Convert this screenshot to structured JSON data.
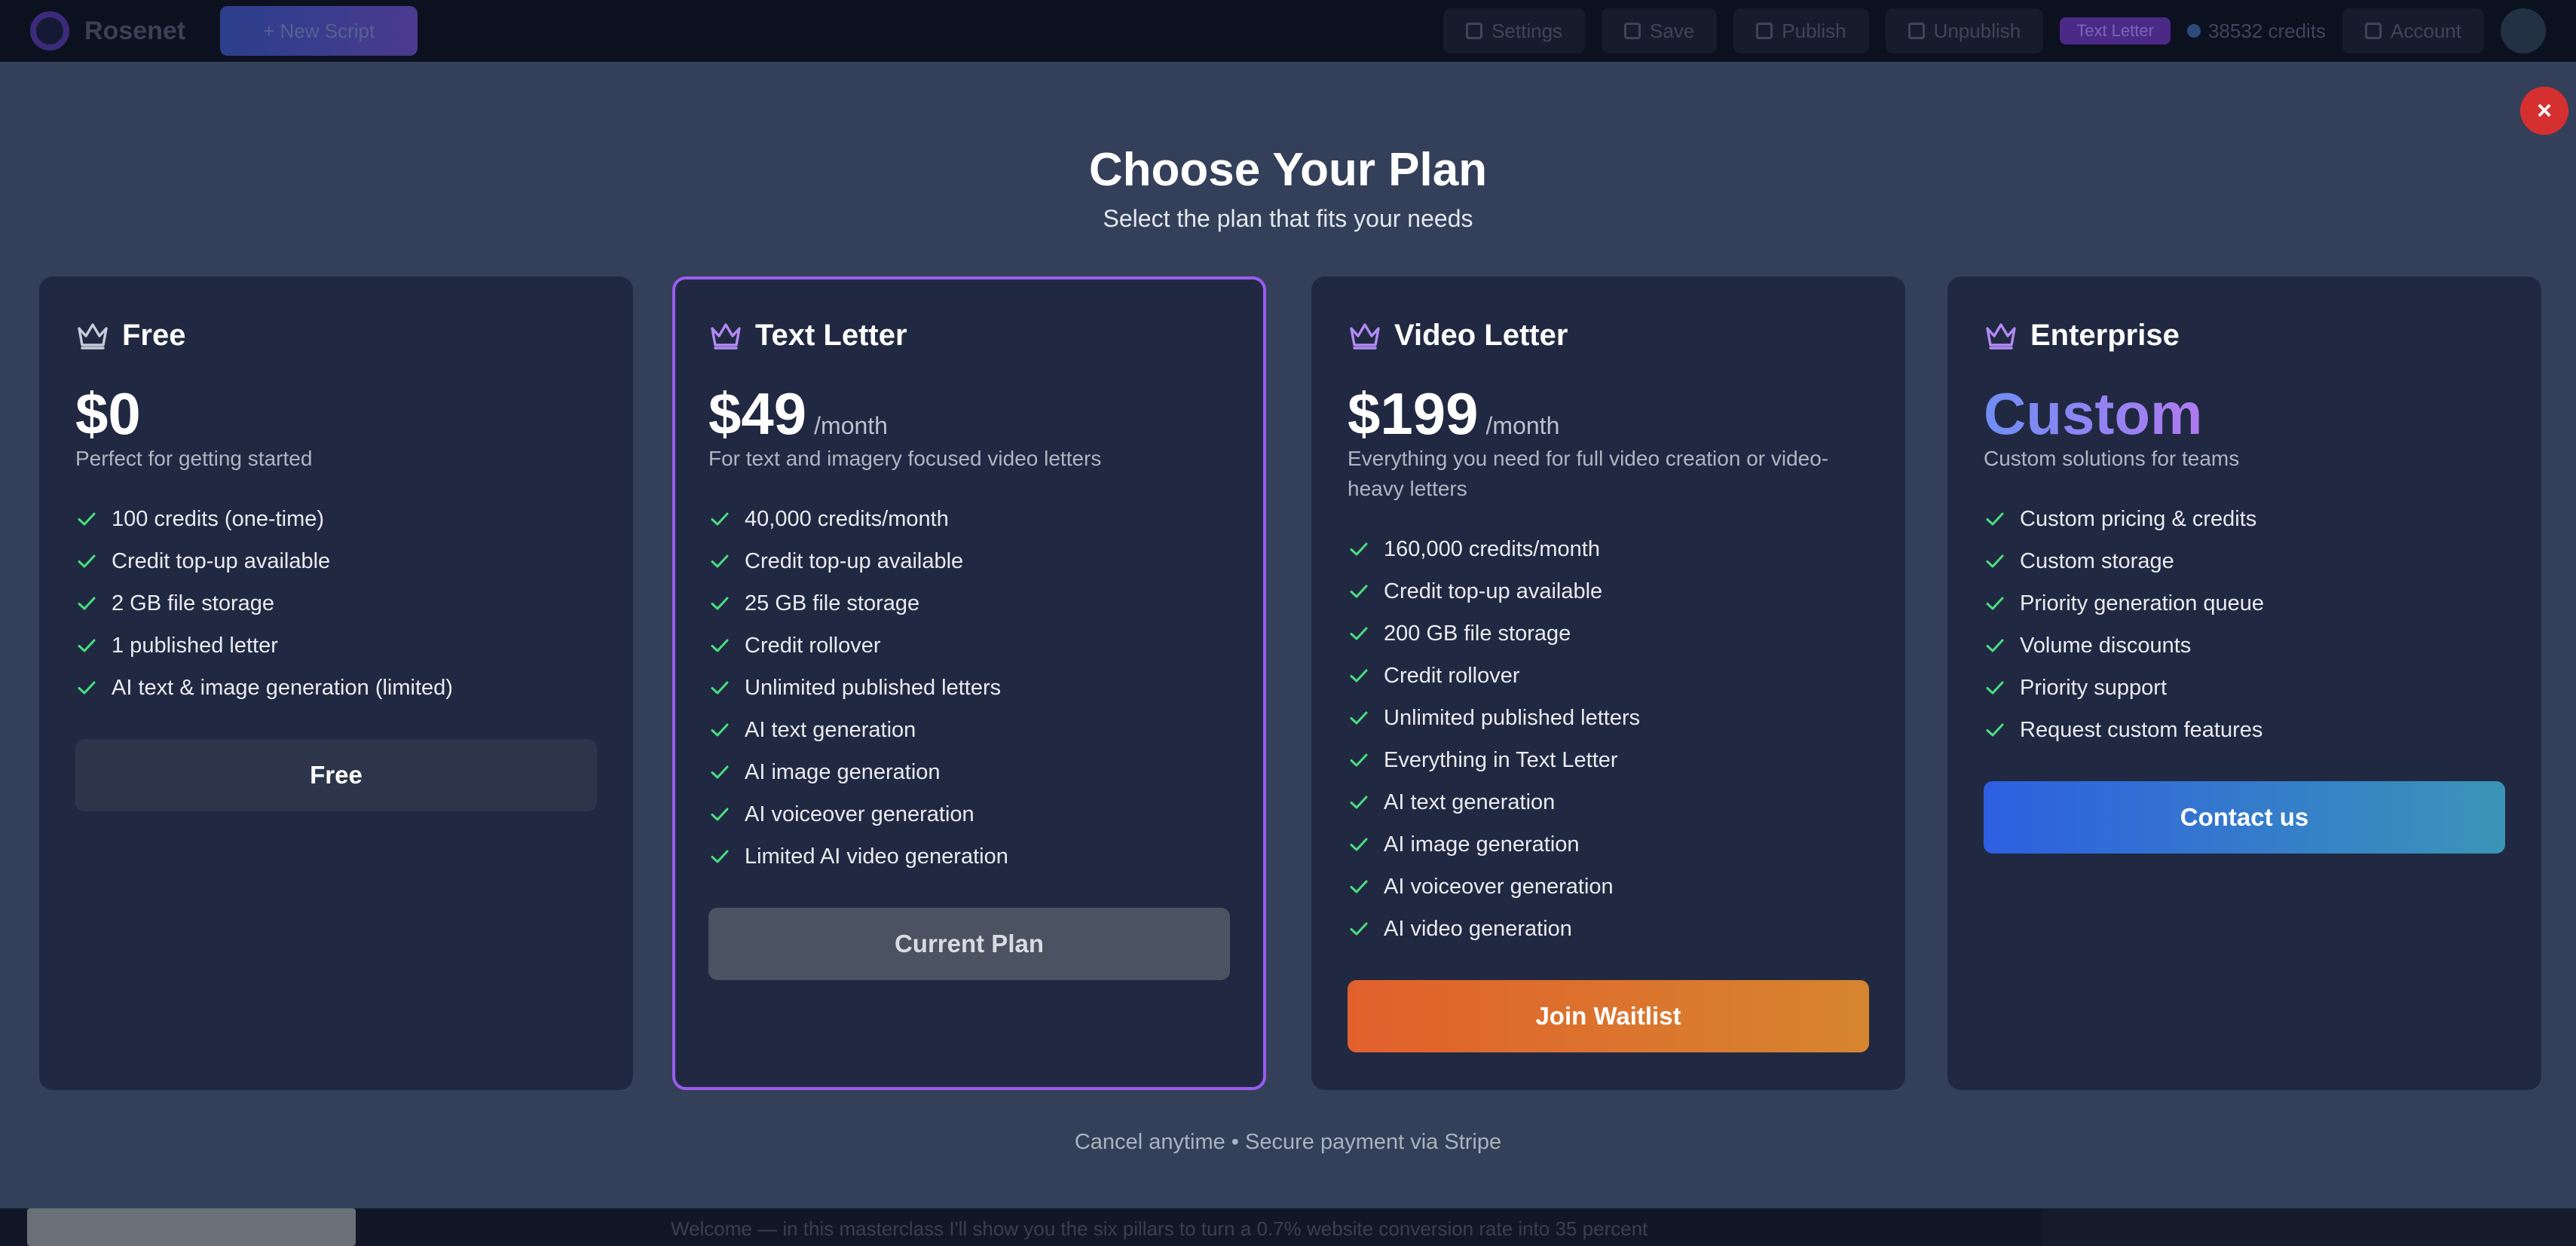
{
  "app": {
    "brand": "Rosenet",
    "new_button": "+ New Script",
    "nav": [
      "Settings",
      "Save",
      "Publish",
      "Unpublish"
    ],
    "plan_badge": "Text Letter",
    "credits": "38532 credits",
    "account": "Account",
    "bottom_text": "Welcome — in this masterclass I'll show you the six pillars to turn a 0.7% website conversion rate into 35 percent"
  },
  "modal": {
    "close_label": "×",
    "title": "Choose Your Plan",
    "subtitle": "Select the plan that fits your needs",
    "footer": "Cancel anytime • Secure payment via Stripe"
  },
  "plans": [
    {
      "name": "Free",
      "price": "$0",
      "period": "",
      "description": "Perfect for getting started",
      "features": [
        "100 credits (one-time)",
        "Credit top-up available",
        "2 GB file storage",
        "1 published letter",
        "AI text & image generation (limited)"
      ],
      "cta": "Free"
    },
    {
      "name": "Text Letter",
      "price": "$49",
      "period": "/month",
      "description": "For text and imagery focused video letters",
      "features": [
        "40,000 credits/month",
        "Credit top-up available",
        "25 GB file storage",
        "Credit rollover",
        "Unlimited published letters",
        "AI text generation",
        "AI image generation",
        "AI voiceover generation",
        "Limited AI video generation"
      ],
      "cta": "Current Plan"
    },
    {
      "name": "Video Letter",
      "price": "$199",
      "period": "/month",
      "description": "Everything you need for full video creation or video-heavy letters",
      "features": [
        "160,000 credits/month",
        "Credit top-up available",
        "200 GB file storage",
        "Credit rollover",
        "Unlimited published letters",
        "Everything in Text Letter",
        "AI text generation",
        "AI image generation",
        "AI voiceover generation",
        "AI video generation"
      ],
      "cta": "Join Waitlist"
    },
    {
      "name": "Enterprise",
      "price": "Custom",
      "period": "",
      "description": "Custom solutions for teams",
      "features": [
        "Custom pricing & credits",
        "Custom storage",
        "Priority generation queue",
        "Volume discounts",
        "Priority support",
        "Request custom features"
      ],
      "cta": "Contact us"
    }
  ],
  "icons": {
    "plan_icon": "crown-icon",
    "feature_icon": "check-icon",
    "close_icon": "close-icon"
  },
  "colors": {
    "accent_purple": "#9b5cf0",
    "check_green": "#4ade80",
    "close_red": "#d5302f",
    "waitlist_orange": "#e2602c",
    "contact_blue": "#2e5fe0"
  }
}
